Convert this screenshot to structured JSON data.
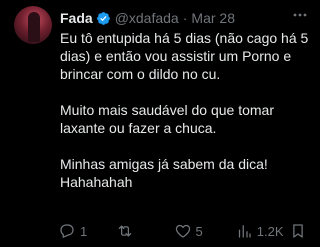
{
  "user": {
    "name": "Fada",
    "handle": "@xdafada",
    "separator": "·",
    "date": "Mar 28",
    "verified": true
  },
  "tweet": {
    "paragraphs": [
      "Eu tô entupida há 5 dias (não cago há 5 dias) e então vou assistir um Porno e brincar com o dildo no cu.",
      "Muito mais saudável do que tomar laxante ou fazer a chuca.",
      "Minhas amigas já sabem da dica! Hahahahah"
    ]
  },
  "actions": {
    "replies": "1",
    "retweets": "",
    "likes": "5",
    "views": "1.2K"
  },
  "icons": {
    "verified": "verified-badge-icon",
    "more": "more-options-icon",
    "reply": "reply-icon",
    "retweet": "retweet-icon",
    "like": "heart-icon",
    "views": "analytics-icon",
    "bookmark": "bookmark-icon"
  },
  "colors": {
    "background": "#000000",
    "text": "#e7e9ea",
    "muted": "#71767b",
    "verified": "#1d9bf0"
  }
}
